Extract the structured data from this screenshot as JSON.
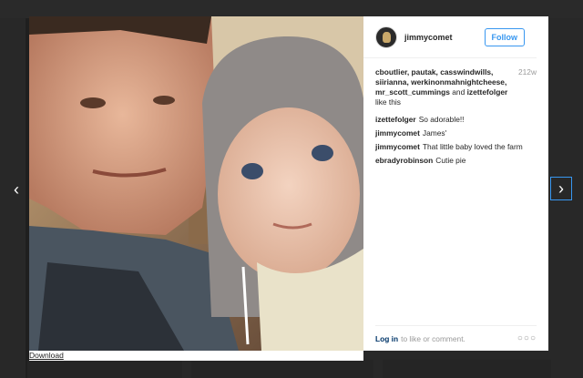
{
  "post": {
    "username": "jimmycomet",
    "follow_label": "Follow",
    "age": "212w",
    "likes": {
      "users": "cboutlier, pautak, casswindwills, siirianna, werkinonmahnightcheese, mr_scott_cummings",
      "and_text": "and",
      "last_user": "izettefolger",
      "suffix": "like this"
    },
    "comments": [
      {
        "user": "izettefolger",
        "text": "So adorable!!"
      },
      {
        "user": "jimmycomet",
        "text": "James'"
      },
      {
        "user": "jimmycomet",
        "text": "That little baby loved the farm"
      },
      {
        "user": "ebradyrobinson",
        "text": "Cutie pie"
      }
    ],
    "footer": {
      "login": "Log in",
      "rest": "to like or comment."
    },
    "more_glyph": "○○○"
  },
  "download_label": "Download",
  "nav": {
    "prev_glyph": "‹",
    "next_glyph": "›"
  },
  "icons": {
    "prev": "chevron-left-icon",
    "next": "chevron-right-icon",
    "more": "more-options-icon",
    "avatar": "avatar-icon"
  },
  "colors": {
    "accent": "#3897f0",
    "link": "#003569",
    "muted": "#999999"
  }
}
